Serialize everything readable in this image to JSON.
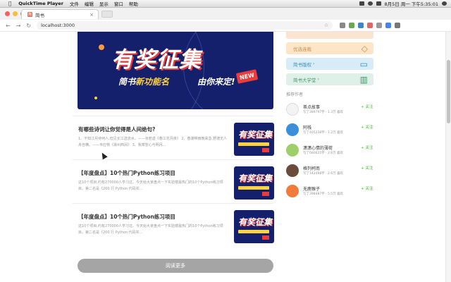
{
  "menubar": {
    "app_name": "QuickTime Player",
    "items": [
      "文件",
      "编辑",
      "显示",
      "窗口",
      "帮助"
    ],
    "clock": "8月5日 周一 下午5:35:01"
  },
  "browser": {
    "tab_title": "简书",
    "tab_favicon": "简",
    "url": "localhost:3000"
  },
  "banner": {
    "headline": "有奖征集",
    "sub_prefix": "简书",
    "sub_highlight": "新功能名",
    "sub_suffix": "由你来定!",
    "new_tag": "NEW"
  },
  "articles": [
    {
      "title": "有哪些诗词让你觉得是人间绝句?",
      "abstract": "1、不知江月待何人,但见长江送流水。——张若虚《春江花月夜》 2、春潮带雨晚来急,野渡无人舟自横。——韦应物《滁州西涧》 3、我寄愁心与明月..."
    },
    {
      "title": "【年度盘点】10个热门Python练习项目",
      "abstract": "这10个项目,约有270000人学习过。今天给大家盘点一下实验楼最热门的10个Python练习项目。第二名是《200 行 Python 代码实..."
    },
    {
      "title": "【年度盘点】10个热门Python练习项目",
      "abstract": "这10个项目,约有270000人学习过。今天给大家盘点一下实验楼最热门的10个Python练习项目。第二名是《200 行 Python 代码实..."
    }
  ],
  "read_more": "阅读更多",
  "sidebar": {
    "links": [
      {
        "label": "",
        "bg": "#fbe4d0",
        "color": "#c98b4f"
      },
      {
        "label": "优选连载",
        "bg": "#fde6c8",
        "color": "#c98b4f"
      },
      {
        "label": "简书版权",
        "bg": "#d7ecf6",
        "color": "#3c8fc4"
      },
      {
        "label": "简书大学堂",
        "bg": "#dff0e8",
        "color": "#3c9a6b"
      }
    ],
    "authors_heading": "推荐作者",
    "follow_label": "+ 关注",
    "authors": [
      {
        "name": "茶点故事",
        "meta": "写了389797字 · 1.3万 喜欢",
        "avatar": "#f3f3f3"
      },
      {
        "name": "阿栈",
        "meta": "写了405238字 · 1.2万 喜欢",
        "avatar": "#3a8fd8"
      },
      {
        "name": "潇潇心情的薄荷",
        "meta": "写了680625字 · 2.6万 喜欢",
        "avatar": "#9fcf6a"
      },
      {
        "name": "格列柯南",
        "meta": "写了142498字 · 2.6万 喜欢",
        "avatar": "#6b4b3a"
      },
      {
        "name": "无鹿猴子",
        "meta": "写了398487字 · 5.5万 喜欢",
        "avatar": "#f07a3c"
      }
    ]
  }
}
